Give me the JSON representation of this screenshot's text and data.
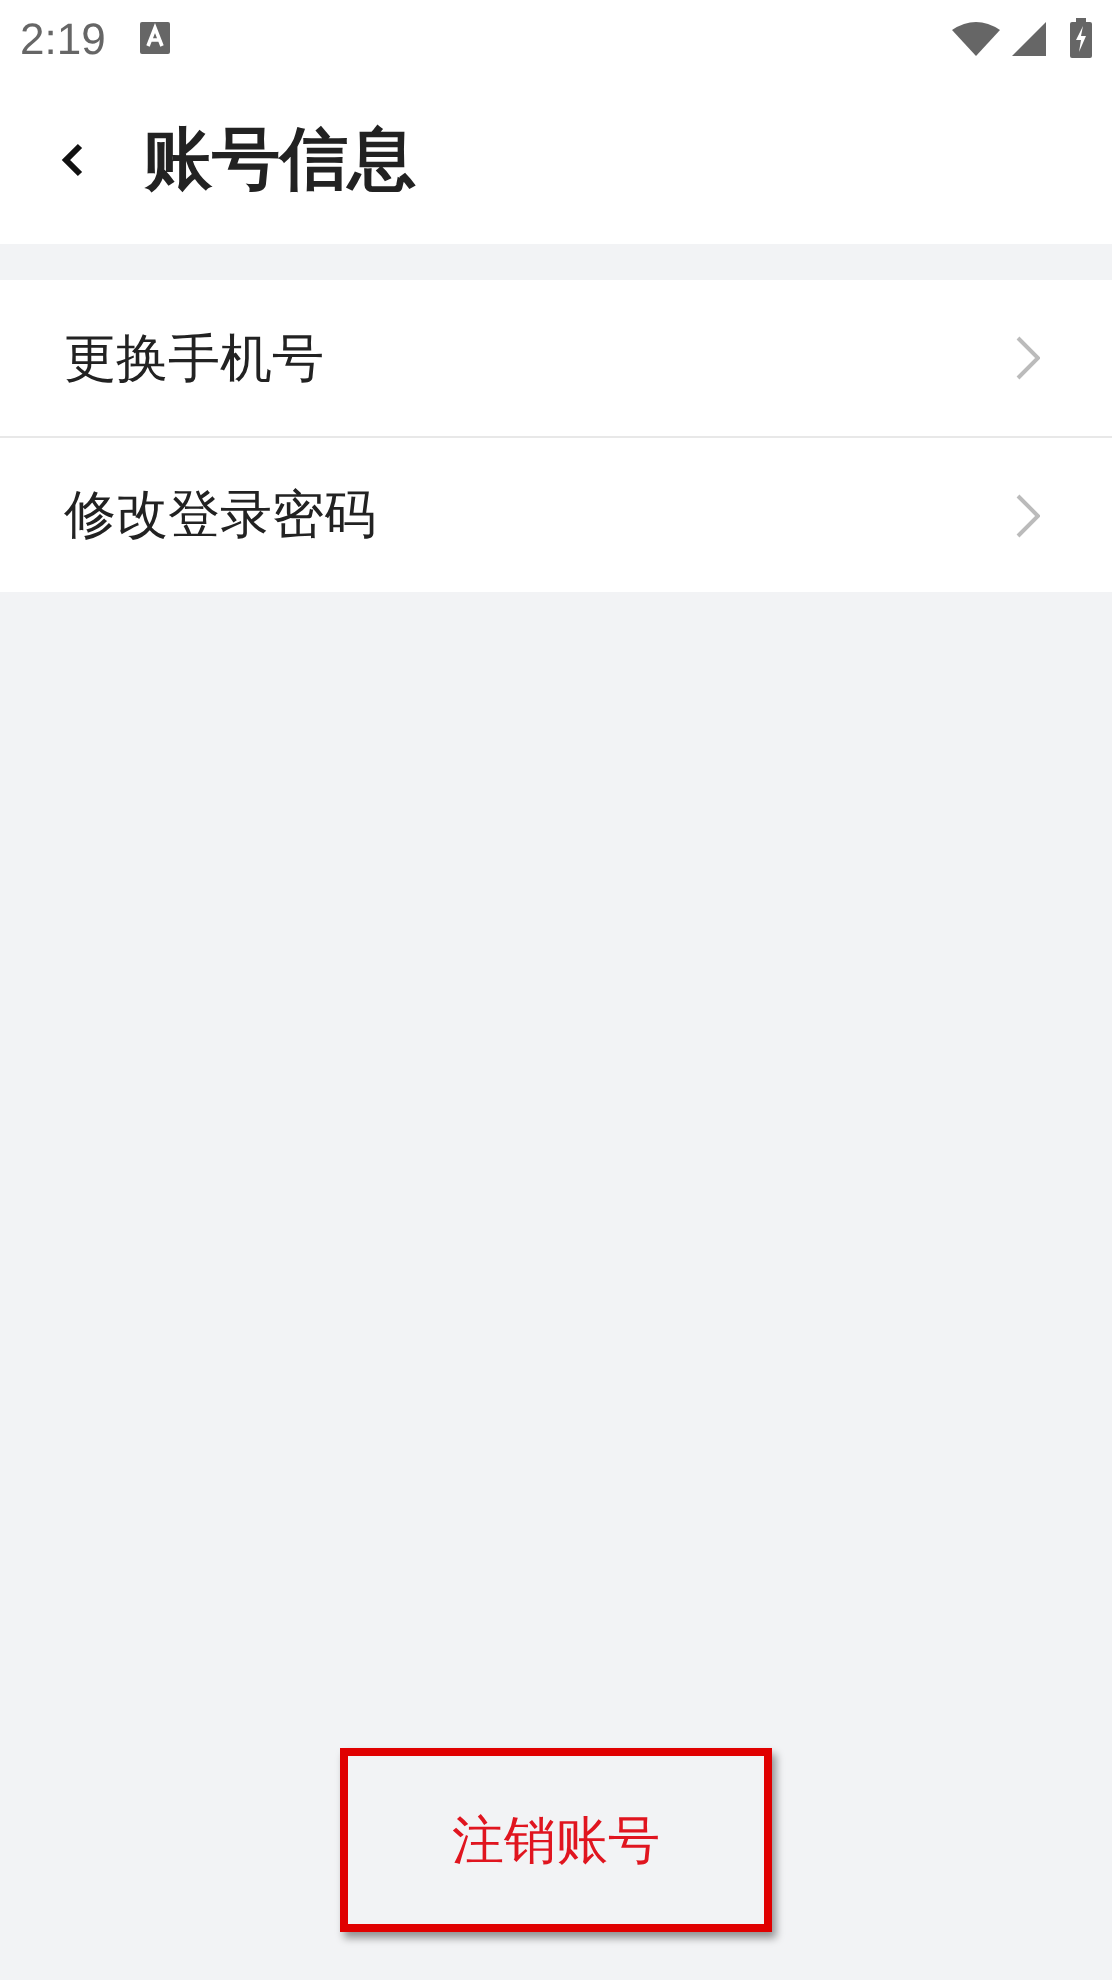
{
  "status_bar": {
    "time": "2:19"
  },
  "header": {
    "title": "账号信息"
  },
  "menu_items": [
    {
      "label": "更换手机号"
    },
    {
      "label": "修改登录密码"
    }
  ],
  "footer_button": {
    "label": "注销账号",
    "highlighted": true
  }
}
